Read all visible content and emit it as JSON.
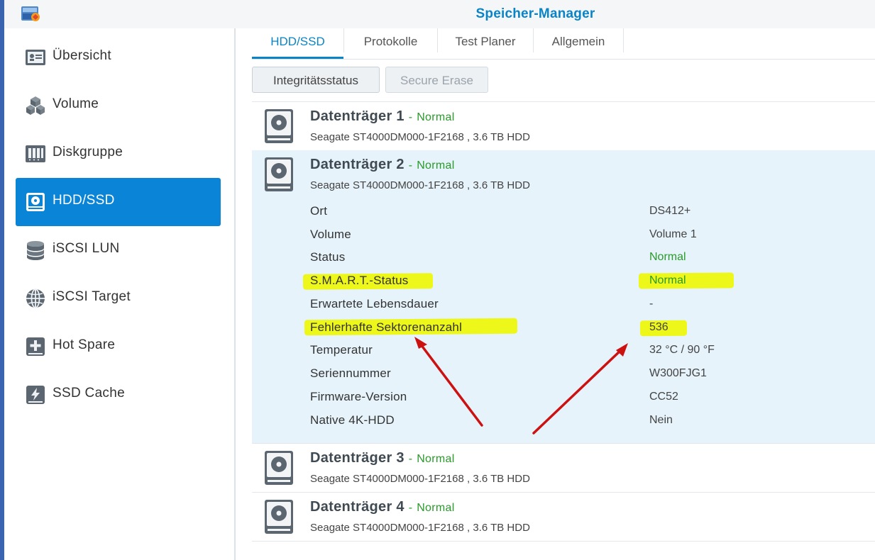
{
  "window": {
    "title": "Speicher-Manager"
  },
  "sidebar": {
    "items": [
      {
        "label": "Übersicht",
        "icon": "overview-icon"
      },
      {
        "label": "Volume",
        "icon": "volume-cubes-icon"
      },
      {
        "label": "Diskgruppe",
        "icon": "diskgroup-icon"
      },
      {
        "label": "HDD/SSD",
        "icon": "hdd-icon",
        "active": true
      },
      {
        "label": "iSCSI LUN",
        "icon": "database-icon"
      },
      {
        "label": "iSCSI Target",
        "icon": "globe-icon"
      },
      {
        "label": "Hot Spare",
        "icon": "hot-spare-plus-icon"
      },
      {
        "label": "SSD Cache",
        "icon": "ssd-cache-icon"
      }
    ]
  },
  "tabs": [
    {
      "label": "HDD/SSD",
      "active": true
    },
    {
      "label": "Protokolle"
    },
    {
      "label": "Test Planer"
    },
    {
      "label": "Allgemein"
    }
  ],
  "toolbar": {
    "integrity_label": "Integritätsstatus",
    "secure_erase_label": "Secure Erase"
  },
  "disks": [
    {
      "name": "Datenträger 1",
      "dash": "-",
      "status": "Normal",
      "model": "Seagate ST4000DM000-1F2168 , 3.6 TB HDD"
    },
    {
      "name": "Datenträger 2",
      "dash": "-",
      "status": "Normal",
      "model": "Seagate ST4000DM000-1F2168 , 3.6 TB HDD"
    },
    {
      "name": "Datenträger 3",
      "dash": "-",
      "status": "Normal",
      "model": "Seagate ST4000DM000-1F2168 , 3.6 TB HDD"
    },
    {
      "name": "Datenträger 4",
      "dash": "-",
      "status": "Normal",
      "model": "Seagate ST4000DM000-1F2168 , 3.6 TB HDD"
    }
  ],
  "details": [
    {
      "label": "Ort",
      "value": "DS412+"
    },
    {
      "label": "Volume",
      "value": "Volume 1"
    },
    {
      "label": "Status",
      "value": "Normal"
    },
    {
      "label": "S.M.A.R.T.-Status",
      "value": "Normal"
    },
    {
      "label": "Erwartete Lebensdauer",
      "value": "-"
    },
    {
      "label": "Fehlerhafte Sektorenanzahl",
      "value": "536"
    },
    {
      "label": "Temperatur",
      "value": "32 °C / 90 °F"
    },
    {
      "label": "Seriennummer",
      "value": "W300FJG1"
    },
    {
      "label": "Firmware-Version",
      "value": "CC52"
    },
    {
      "label": "Native 4K-HDD",
      "value": "Nein"
    }
  ],
  "colors": {
    "accent": "#0a84c6",
    "active_nav": "#0a84d6",
    "status_green": "#2a9a2a",
    "highlight": "#eef71a",
    "annotation_arrow": "#cc1111"
  }
}
